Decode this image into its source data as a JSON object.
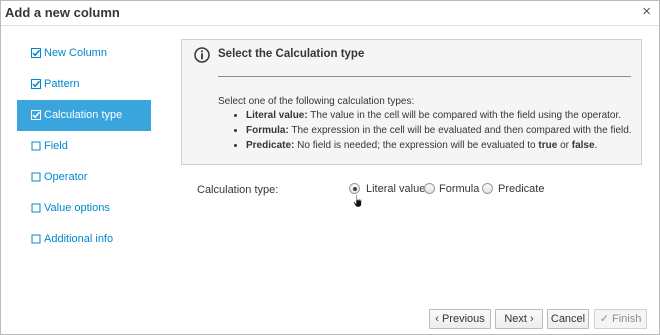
{
  "dialog": {
    "title": "Add a new column",
    "close_glyph": "×"
  },
  "wizard_steps": [
    {
      "label": "New Column",
      "state": "checked"
    },
    {
      "label": "Pattern",
      "state": "checked"
    },
    {
      "label": "Calculation type",
      "state": "checked-active"
    },
    {
      "label": "Field",
      "state": "unchecked"
    },
    {
      "label": "Operator",
      "state": "unchecked"
    },
    {
      "label": "Value options",
      "state": "unchecked"
    },
    {
      "label": "Additional info",
      "state": "unchecked"
    }
  ],
  "info": {
    "icon": "info-circle-icon",
    "title": "Select the Calculation type",
    "intro": "Select one of the following calculation types:",
    "items": [
      {
        "term": "Literal value:",
        "text": " The value in the cell will be compared with the field using the operator."
      },
      {
        "term": "Formula:",
        "text": " The expression in the cell will be evaluated and then compared with the field."
      },
      {
        "term": "Predicate:",
        "text_before": " No field is needed; the expression will be evaluated to ",
        "bold1": "true",
        "middle": " or ",
        "bold2": "false",
        "text_after": "."
      }
    ]
  },
  "calculation": {
    "label": "Calculation type:",
    "options": [
      {
        "label": "Literal value",
        "selected": true
      },
      {
        "label": "Formula",
        "selected": false
      },
      {
        "label": "Predicate",
        "selected": false
      }
    ]
  },
  "footer": {
    "previous": "Previous",
    "previous_icon": "chevron-left-icon",
    "next": "Next",
    "next_icon": "chevron-right-icon",
    "cancel": "Cancel",
    "finish": "Finish",
    "finish_icon": "check-icon"
  },
  "colors": {
    "accent": "#39a5dc",
    "link": "#0088ce",
    "info_bg": "#f5f5f5"
  }
}
